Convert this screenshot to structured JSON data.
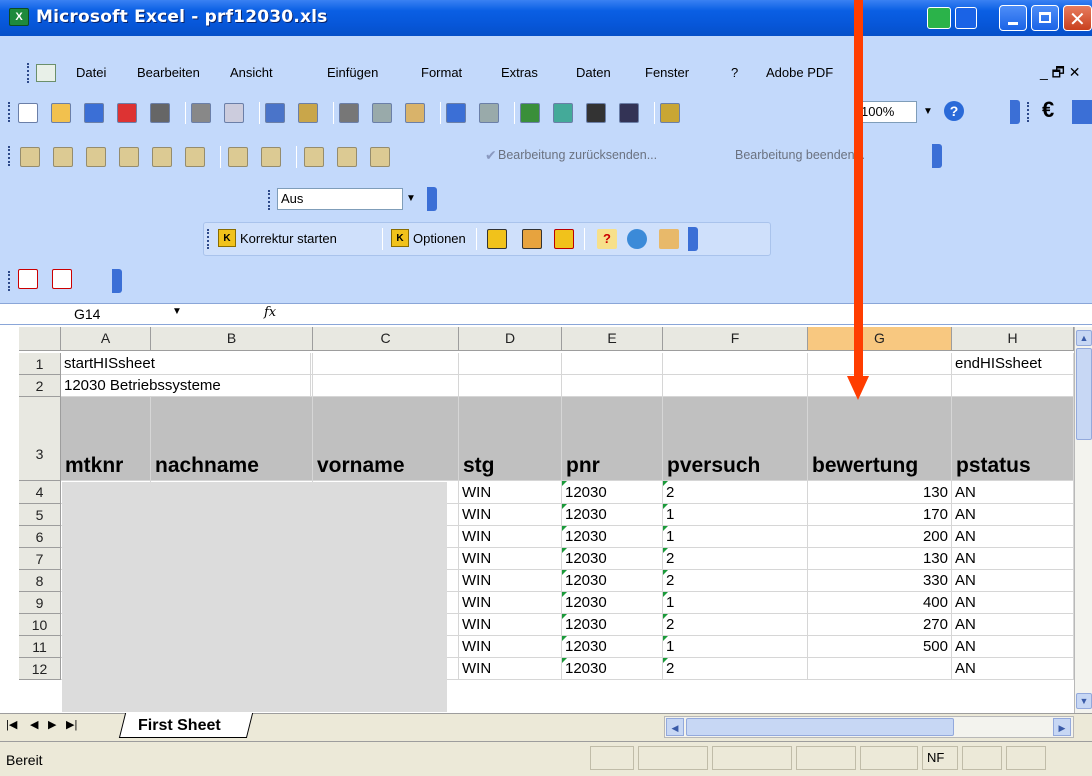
{
  "window": {
    "title": "Microsoft Excel - prf12030.xls",
    "app_icon": "excel-icon"
  },
  "menu": [
    "Datei",
    "Bearbeiten",
    "Ansicht",
    "Einfügen",
    "Format",
    "Extras",
    "Daten",
    "Fenster",
    "?",
    "Adobe PDF"
  ],
  "toolbar": {
    "zoom": "100%",
    "review_send": "Bearbeitung zurücksenden...",
    "review_end": "Bearbeitung beenden...",
    "euro": "€",
    "dropdown_value": "Aus",
    "korrektur_start": "Korrektur starten",
    "optionen": "Optionen"
  },
  "formula_bar": {
    "name_box": "G14",
    "fx": "fx",
    "value": ""
  },
  "columns": [
    "A",
    "B",
    "C",
    "D",
    "E",
    "F",
    "G",
    "H"
  ],
  "selected_column": "G",
  "rows": [
    {
      "num": "1",
      "cells": [
        "startHISsheet",
        "",
        "",
        "",
        "",
        "",
        "",
        "endHISsheet"
      ]
    },
    {
      "num": "2",
      "cells": [
        "12030  Betriebssysteme",
        "",
        "",
        "",
        "",
        "",
        "",
        ""
      ]
    },
    {
      "num": "3",
      "cells": [
        "mtknr",
        "nachname",
        "vorname",
        "stg",
        "pnr",
        "pversuch",
        "bewertung",
        "pstatus"
      ]
    },
    {
      "num": "4",
      "cells": [
        "",
        "",
        "",
        "WIN",
        "12030",
        "2",
        "130",
        "AN"
      ]
    },
    {
      "num": "5",
      "cells": [
        "",
        "",
        "",
        "WIN",
        "12030",
        "1",
        "170",
        "AN"
      ]
    },
    {
      "num": "6",
      "cells": [
        "",
        "",
        "",
        "WIN",
        "12030",
        "1",
        "200",
        "AN"
      ]
    },
    {
      "num": "7",
      "cells": [
        "",
        "",
        "",
        "WIN",
        "12030",
        "2",
        "130",
        "AN"
      ]
    },
    {
      "num": "8",
      "cells": [
        "",
        "",
        "",
        "WIN",
        "12030",
        "2",
        "330",
        "AN"
      ]
    },
    {
      "num": "9",
      "cells": [
        "",
        "",
        "",
        "WIN",
        "12030",
        "1",
        "400",
        "AN"
      ]
    },
    {
      "num": "10",
      "cells": [
        "",
        "",
        "",
        "WIN",
        "12030",
        "2",
        "270",
        "AN"
      ]
    },
    {
      "num": "11",
      "cells": [
        "",
        "",
        "",
        "WIN",
        "12030",
        "1",
        "500",
        "AN"
      ]
    },
    {
      "num": "12",
      "cells": [
        "",
        "",
        "",
        "WIN",
        "12030",
        "2",
        "",
        "AN"
      ]
    }
  ],
  "sheet_tab": "First Sheet",
  "status": {
    "left": "Bereit",
    "nf": "NF"
  },
  "colors": {
    "accent_arrow": "#ff3d00",
    "header_fill": "#c0c0c0",
    "selected_col": "#f8c880"
  }
}
